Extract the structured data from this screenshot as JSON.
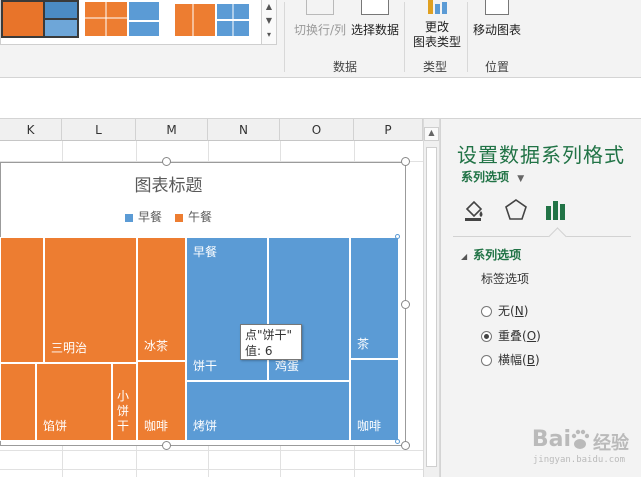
{
  "ribbon": {
    "buttons": {
      "switch_row_col": "切换行/列",
      "select_data": "选择数据",
      "change_type_l1": "更改",
      "change_type_l2": "图表类型",
      "move_chart": "移动图表"
    },
    "groups": {
      "data": "数据",
      "type": "类型",
      "location": "位置"
    }
  },
  "sheet": {
    "columns": [
      "K",
      "L",
      "M",
      "N",
      "O",
      "P"
    ]
  },
  "chart": {
    "title": "图表标题",
    "legend": [
      {
        "label": "早餐",
        "color": "#5b9bd5"
      },
      {
        "label": "午餐",
        "color": "#ed7d31"
      }
    ],
    "tile_labels": {
      "sandwich": "三明治",
      "ice_tea": "冰茶",
      "pie": "馅饼",
      "small_biscuit": "小饼干",
      "coffee_lunch": "咖啡",
      "breakfast": "早餐",
      "biscuit": "饼干",
      "egg": "鸡蛋",
      "tea": "茶",
      "toast": "烤饼",
      "coffee_breakfast": "咖啡"
    },
    "tooltip": {
      "line1": "点\"饼干\"",
      "line2": "值: 6"
    },
    "chart_data": {
      "type": "treemap",
      "title": "图表标题",
      "series": [
        {
          "name": "午餐",
          "categories": [
            "三明治",
            "冰茶",
            "馅饼",
            "小饼干",
            "咖啡"
          ]
        },
        {
          "name": "早餐",
          "categories": [
            "饼干",
            "鸡蛋",
            "茶",
            "烤饼",
            "咖啡"
          ]
        }
      ],
      "annotations": [
        {
          "category": "饼干",
          "value": 6
        }
      ],
      "legend_position": "top"
    }
  },
  "pane": {
    "title": "设置数据系列格式",
    "subtitle": "系列选项",
    "section": "系列选项",
    "label_options": "标签选项",
    "radios": [
      {
        "label": "无",
        "key": "N",
        "selected": false
      },
      {
        "label": "重叠",
        "key": "O",
        "selected": true
      },
      {
        "label": "横幅",
        "key": "B",
        "selected": false
      }
    ],
    "accent_color": "#217346"
  },
  "watermark": {
    "brand": "Bai",
    "cn": "经验",
    "url": "jingyan.baidu.com"
  }
}
